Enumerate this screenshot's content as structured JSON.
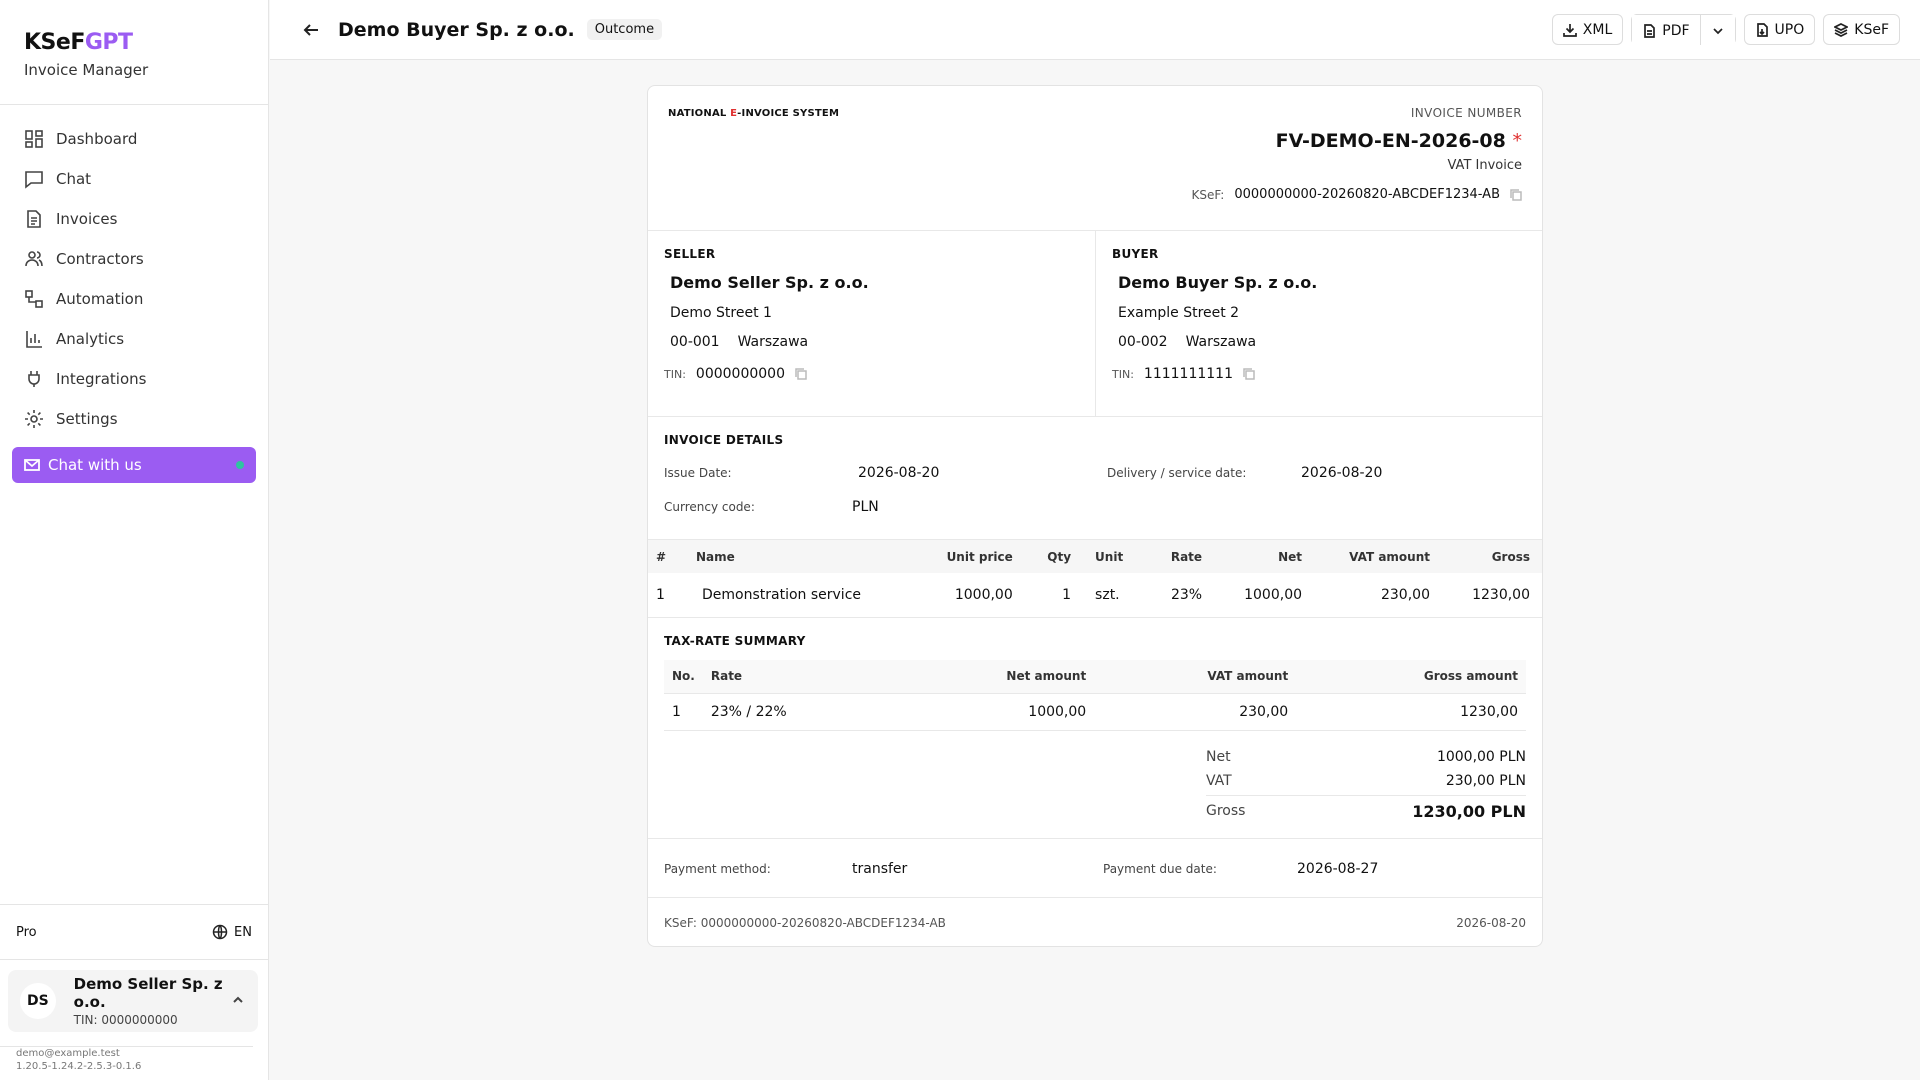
{
  "brand": {
    "logo_main": "KSeF",
    "logo_accent": "GPT",
    "subtitle": "Invoice Manager"
  },
  "nav": {
    "items": [
      {
        "label": "Dashboard",
        "icon": "dashboard-icon"
      },
      {
        "label": "Chat",
        "icon": "chat-icon"
      },
      {
        "label": "Invoices",
        "icon": "invoice-icon"
      },
      {
        "label": "Contractors",
        "icon": "users-icon"
      },
      {
        "label": "Automation",
        "icon": "automation-icon"
      },
      {
        "label": "Analytics",
        "icon": "chart-icon"
      },
      {
        "label": "Integrations",
        "icon": "plug-icon"
      },
      {
        "label": "Settings",
        "icon": "gear-icon"
      }
    ],
    "chat_cta": "Chat with us"
  },
  "account": {
    "plan": "Pro",
    "lang": "EN",
    "initials": "DS",
    "name": "Demo Seller Sp. z o.o.",
    "tin": "TIN: 0000000000",
    "email": "demo@example.test",
    "version": "1.20.5-1.24.2-2.5.3-0.1.6"
  },
  "header": {
    "title": "Demo Buyer Sp. z o.o.",
    "badge": "Outcome",
    "actions": {
      "xml": "XML",
      "pdf": "PDF",
      "upo": "UPO",
      "ksef": "KSeF"
    }
  },
  "invoice": {
    "system_pre": "NATIONAL ",
    "system_e": "E",
    "system_post": "-INVOICE SYSTEM",
    "number_label": "INVOICE NUMBER",
    "number": "FV-DEMO-EN-2026-08",
    "type": "VAT Invoice",
    "ksef_label": "KSeF:",
    "ksef_no": "0000000000-20260820-ABCDEF1234-AB",
    "seller": {
      "title": "SELLER",
      "name": "Demo Seller Sp. z o.o.",
      "street": "Demo Street 1",
      "zip": "00-001",
      "city": "Warszawa",
      "tin_label": "TIN:",
      "tin": "0000000000"
    },
    "buyer": {
      "title": "BUYER",
      "name": "Demo Buyer Sp. z o.o.",
      "street": "Example Street 2",
      "zip": "00-002",
      "city": "Warszawa",
      "tin_label": "TIN:",
      "tin": "1111111111"
    },
    "details": {
      "title": "INVOICE DETAILS",
      "issue_label": "Issue Date:",
      "issue": "2026-08-20",
      "delivery_label": "Delivery / service date:",
      "delivery": "2026-08-20",
      "currency_label": "Currency code:",
      "currency": "PLN"
    },
    "items_headers": [
      "#",
      "Name",
      "Unit price",
      "Qty",
      "Unit",
      "Rate",
      "Net",
      "VAT amount",
      "Gross"
    ],
    "items": [
      {
        "no": "1",
        "name": "Demonstration service",
        "unit_price": "1000,00",
        "qty": "1",
        "unit": "szt.",
        "rate": "23%",
        "net": "1000,00",
        "vat": "230,00",
        "gross": "1230,00"
      }
    ],
    "summary": {
      "title": "TAX-RATE SUMMARY",
      "headers": [
        "No.",
        "Rate",
        "Net amount",
        "VAT amount",
        "Gross amount"
      ],
      "rows": [
        {
          "no": "1",
          "rate": "23% / 22%",
          "net": "1000,00",
          "vat": "230,00",
          "gross": "1230,00"
        }
      ],
      "net_label": "Net",
      "net": "1000,00 PLN",
      "vat_label": "VAT",
      "vat": "230,00 PLN",
      "gross_label": "Gross",
      "gross": "1230,00 PLN"
    },
    "payment": {
      "method_label": "Payment method:",
      "method": "transfer",
      "due_label": "Payment due date:",
      "due": "2026-08-27"
    },
    "footer": {
      "ksef": "KSeF: 0000000000-20260820-ABCDEF1234-AB",
      "date": "2026-08-20"
    }
  }
}
